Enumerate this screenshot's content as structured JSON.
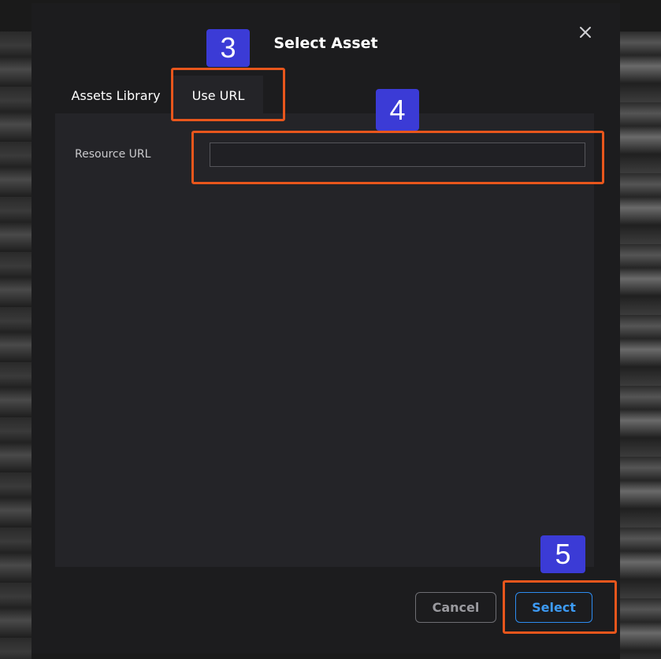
{
  "dialog": {
    "title": "Select Asset",
    "close_icon": "close-icon"
  },
  "tabs": [
    {
      "label": "Assets Library",
      "active": false
    },
    {
      "label": "Use URL",
      "active": true
    }
  ],
  "form": {
    "resource_url_label": "Resource URL",
    "resource_url_value": "",
    "resource_url_placeholder": ""
  },
  "footer": {
    "cancel_label": "Cancel",
    "select_label": "Select"
  },
  "annotations": [
    {
      "number": "3"
    },
    {
      "number": "4"
    },
    {
      "number": "5"
    }
  ],
  "colors": {
    "highlight": "#e8561c",
    "badge": "#3b3bd6",
    "accent": "#2d8cf0"
  }
}
